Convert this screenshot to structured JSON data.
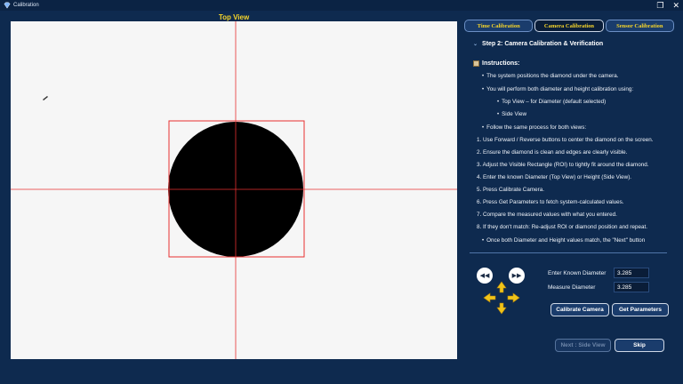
{
  "window": {
    "title": "Calibration",
    "restore_glyph": "❐",
    "close_glyph": "✕"
  },
  "camera_view": {
    "title": "Top View"
  },
  "tabs": [
    {
      "label": "Time Calibration",
      "active": false
    },
    {
      "label": "Camera Calibration",
      "active": true
    },
    {
      "label": "Sensor Calibration",
      "active": false
    }
  ],
  "step": {
    "arrow": "⌄",
    "title": "Step 2: Camera Calibration & Verification"
  },
  "instructions": {
    "heading": "Instructions:",
    "bullet": "•",
    "intro_1": "The system positions the diamond under the camera.",
    "intro_2": "You will perform both diameter and height calibration using:",
    "sub_1": "Top View – for Diameter (default selected)",
    "sub_2": "Side View",
    "intro_3": "Follow the same process for both views:",
    "steps": [
      "1. Use Forward / Reverse buttons to center the diamond on the screen.",
      "2. Ensure the diamond is clean and edges are clearly visible.",
      "3. Adjust the Visible Rectangle (ROI) to tightly fit around the diamond.",
      "4. Enter the known Diameter (Top View) or Height (Side View).",
      "5. Press Calibrate Camera.",
      "6. Press Get Parameters to fetch system-calculated values.",
      "7. Compare the measured values with what you entered.",
      "8. If they don't match: Re-adjust ROI or diamond position and repeat."
    ],
    "outro": "Once both Diameter and Height values match, the \"Next\" button"
  },
  "controls": {
    "reverse_glyph": "◀◀",
    "forward_glyph": "▶▶",
    "known_label": "Enter Known Diameter",
    "known_value": "3.285",
    "measure_label": "Measure Diameter",
    "measure_value": "3.285",
    "calibrate_label": "Calibrate Camera",
    "get_params_label": "Get Parameters",
    "next_label": "Next : Side View",
    "skip_label": "Skip"
  },
  "colors": {
    "accent": "#f5d42a",
    "crosshair": "#e83030",
    "dpad": "#f0c419"
  }
}
